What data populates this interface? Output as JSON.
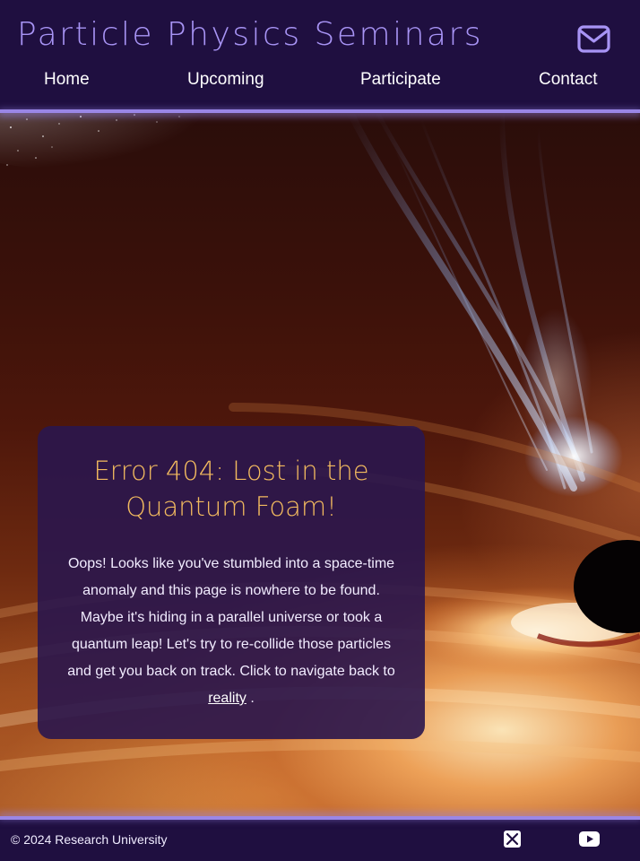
{
  "header": {
    "title": "Particle Physics Seminars",
    "mail_icon": "envelope-icon",
    "nav": [
      {
        "label": "Home"
      },
      {
        "label": "Upcoming"
      },
      {
        "label": "Participate"
      },
      {
        "label": "Contact"
      }
    ]
  },
  "hero": {
    "background": "black-hole-accretion-disk"
  },
  "error": {
    "title": "Error 404: Lost in the Quantum Foam!",
    "body": "Oops! Looks like you've stumbled into a space-time anomaly and this page is nowhere to be found. Maybe it's hiding in a parallel universe or took a quantum leap! Let's try to re-collide those particles and get you back on track. Click to navigate back to",
    "link_text": "reality",
    "suffix": " ."
  },
  "footer": {
    "copyright": "© 2024 Research University",
    "social": [
      {
        "icon": "x-icon"
      },
      {
        "icon": "youtube-icon"
      }
    ]
  },
  "colors": {
    "header_bg": "#1f0f40",
    "title": "#a894f5",
    "accent_line": "#9a86e6",
    "card_bg": "#2a164e",
    "card_title": "#f3bb5f"
  }
}
